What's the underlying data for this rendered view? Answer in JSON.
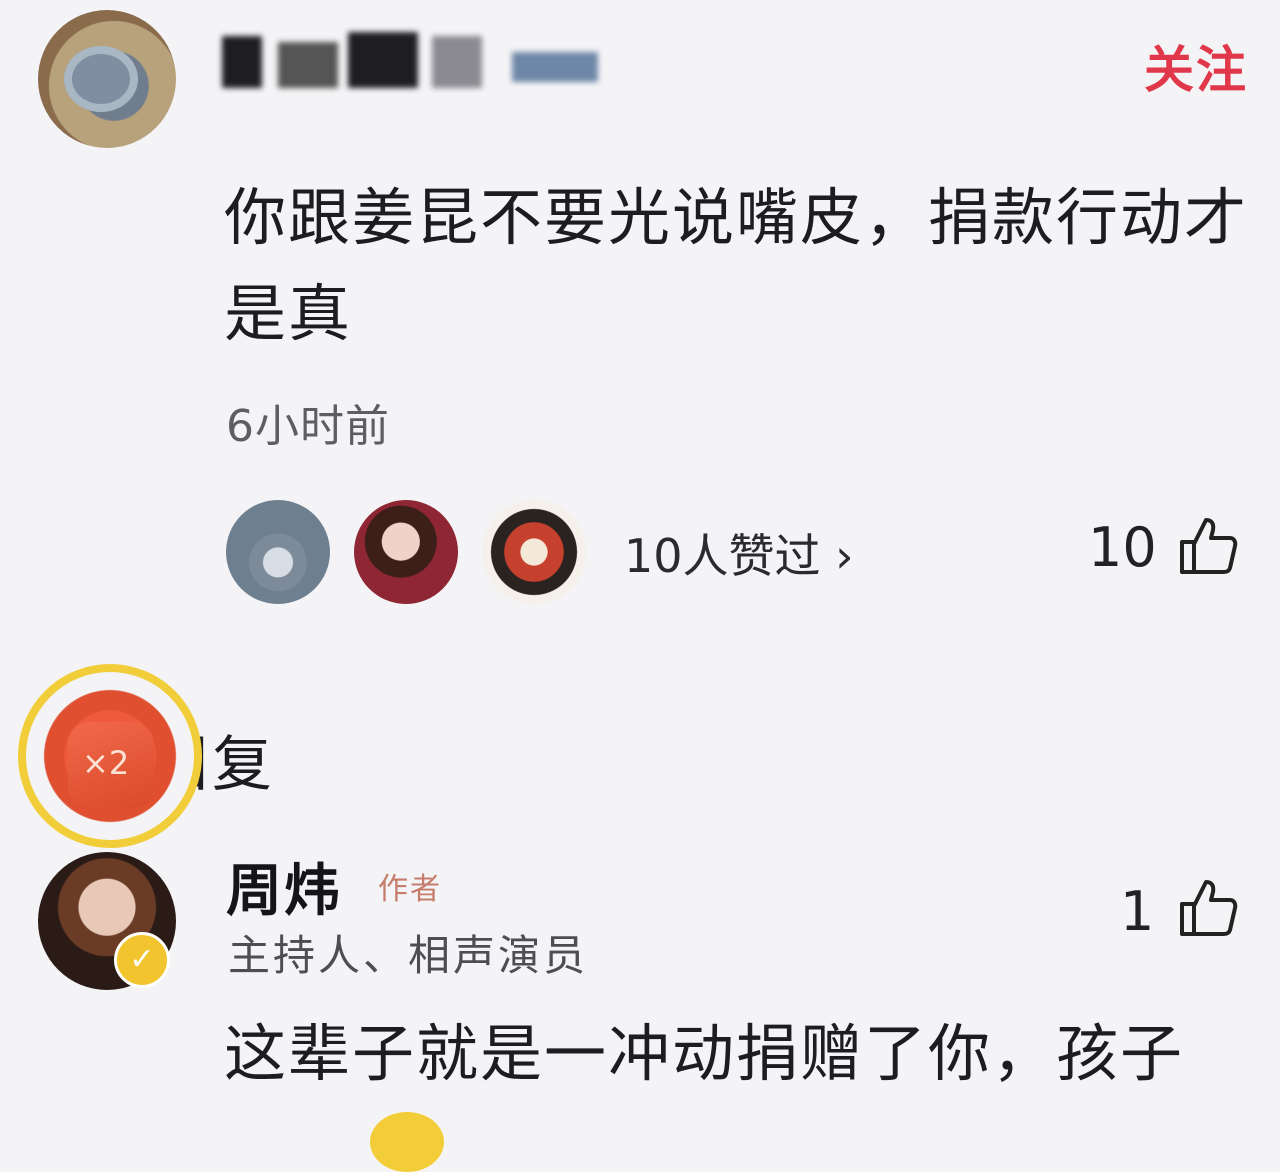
{
  "comment": {
    "follow_label": "关注",
    "text": "你跟姜昆不要光说嘴皮，捐款行动才是真",
    "time": "6小时前",
    "likes_summary": "10人赞过 ›",
    "like_count": "10"
  },
  "reply": {
    "badge_count": "×2",
    "section_label": "全部回复",
    "author_name": "周炜",
    "author_tag": "作者",
    "author_title": "主持人、相声演员",
    "like_count": "1",
    "text": "这辈子就是一冲动捐赠了你，孩子"
  },
  "colors": {
    "follow": "#e0384a",
    "badge_ring": "#f2cd3a",
    "verified": "#f2c42e"
  },
  "icons": {
    "like": "thumbs-up-icon",
    "verified": "check-icon"
  }
}
